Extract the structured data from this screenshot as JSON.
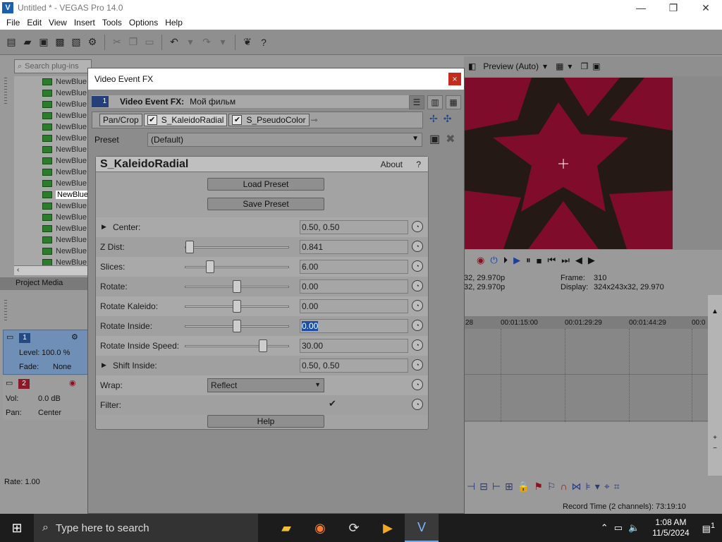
{
  "window": {
    "title": "Untitled * - VEGAS Pro 14.0",
    "app_icon": "V",
    "minimize": "—",
    "maximize": "❐",
    "close": "✕"
  },
  "menu": [
    "File",
    "Edit",
    "View",
    "Insert",
    "Tools",
    "Options",
    "Help"
  ],
  "toolbar_icons": [
    "new-icon",
    "open-icon",
    "save-icon",
    "save-as-icon",
    "render-icon",
    "properties-icon",
    "cut-icon",
    "copy-icon",
    "paste-icon",
    "undo-icon",
    "redo-icon",
    "fx-icon",
    "help-icon"
  ],
  "explorer": {
    "search_placeholder": "Search plug-ins",
    "items": [
      "NewBlue",
      "NewBlue",
      "NewBlue",
      "NewBlue",
      "NewBlue",
      "NewBlue",
      "NewBlue",
      "NewBlue",
      "NewBlue",
      "NewBlue",
      "NewBlue",
      "NewBlue",
      "NewBlue",
      "NewBlue",
      "NewBlue",
      "NewBlue",
      "NewBlue"
    ],
    "selected_index": 10,
    "tab_label": "Project Media"
  },
  "preview": {
    "quality": "Preview (Auto)",
    "info_left_1": "32, 29.970p",
    "info_left_2": "32, 29.970p",
    "frame_label": "Frame:",
    "frame_value": "310",
    "display_label": "Display:",
    "display_value": "324x243x32, 29.970"
  },
  "timeline": {
    "ticks": [
      "28",
      "00:01:15:00",
      "00:01:29:29",
      "00:01:44:29",
      "00:0"
    ]
  },
  "tracks": {
    "video": {
      "number": "1",
      "level_label": "Level:",
      "level_value": "100.0 %",
      "fade_label": "Fade:",
      "fade_value": "None"
    },
    "audio": {
      "number": "2",
      "vol_label": "Vol:",
      "vol_value": "0.0 dB",
      "pan_label": "Pan:",
      "pan_value": "Center"
    },
    "rate": "Rate: 1.00"
  },
  "status": {
    "record_time": "Record Time (2 channels): 73:19:10"
  },
  "dialog": {
    "title": "Video Event FX",
    "close": "×",
    "track_number": "1",
    "header_label": "Video Event FX:",
    "header_value": "Мой фильм",
    "chain": [
      {
        "label": "Pan/Crop",
        "checked": false
      },
      {
        "label": "S_KaleidoRadial",
        "checked": true
      },
      {
        "label": "S_PseudoColor",
        "checked": true
      }
    ],
    "preset_label": "Preset",
    "preset_value": "(Default)",
    "plugin": {
      "name": "S_KaleidoRadial",
      "about": "About",
      "help_q": "?",
      "load_preset": "Load Preset",
      "save_preset": "Save Preset",
      "help": "Help",
      "params": [
        {
          "label": "Center:",
          "type": "expand",
          "value": "0.50, 0.50"
        },
        {
          "label": "Z Dist:",
          "type": "slider",
          "value": "0.841",
          "pos": 0.05
        },
        {
          "label": "Slices:",
          "type": "slider",
          "value": "6.00",
          "pos": 0.24
        },
        {
          "label": "Rotate:",
          "type": "slider",
          "value": "0.00",
          "pos": 0.5
        },
        {
          "label": "Rotate Kaleido:",
          "type": "slider",
          "value": "0.00",
          "pos": 0.5
        },
        {
          "label": "Rotate Inside:",
          "type": "slider",
          "value": "0.00",
          "pos": 0.5,
          "selected": true
        },
        {
          "label": "Rotate Inside Speed:",
          "type": "slider",
          "value": "30.00",
          "pos": 0.75
        },
        {
          "label": "Shift Inside:",
          "type": "expand",
          "value": "0.50, 0.50"
        },
        {
          "label": "Wrap:",
          "type": "dropdown",
          "value": "Reflect"
        },
        {
          "label": "Filter:",
          "type": "checkbox",
          "value": "✔"
        }
      ]
    }
  },
  "taskbar": {
    "search_placeholder": "Type here to search",
    "time": "1:08 AM",
    "date": "11/5/2024",
    "notification_count": "1"
  },
  "colors": {
    "preview_red": "#800c2c",
    "star_dark": "#1f1a14",
    "selection_blue": "#1e4fa8",
    "close_red": "#c42b1c"
  }
}
